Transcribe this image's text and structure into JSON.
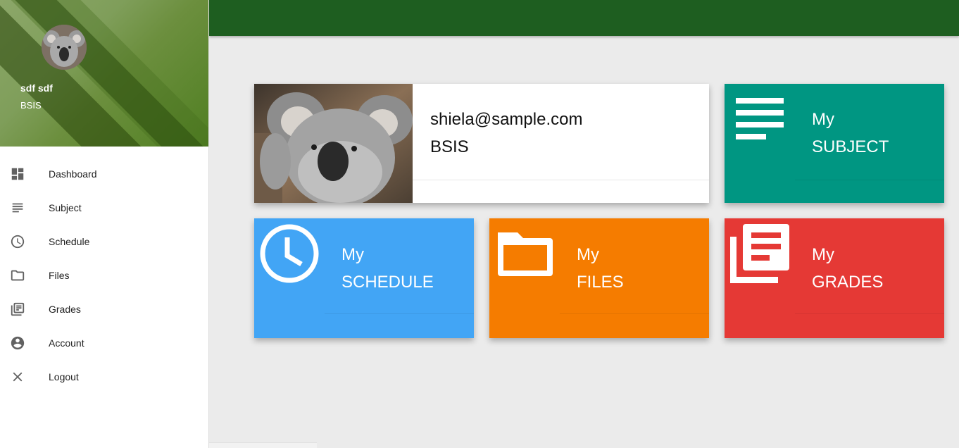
{
  "profile": {
    "name": "sdf sdf",
    "course": "BSIS"
  },
  "nav": {
    "items": [
      {
        "label": "Dashboard",
        "icon": "dashboard-icon"
      },
      {
        "label": "Subject",
        "icon": "subject-icon"
      },
      {
        "label": "Schedule",
        "icon": "clock-icon"
      },
      {
        "label": "Files",
        "icon": "folder-icon"
      },
      {
        "label": "Grades",
        "icon": "library-books-icon"
      },
      {
        "label": "Account",
        "icon": "account-circle-icon"
      },
      {
        "label": "Logout",
        "icon": "close-icon"
      }
    ]
  },
  "main": {
    "info_card": {
      "email": "shiela@sample.com",
      "course": "BSIS"
    },
    "tiles": {
      "subject": {
        "line1": "My",
        "line2": "SUBJECT",
        "color": "#009682"
      },
      "schedule": {
        "line1": "My",
        "line2": "SCHEDULE",
        "color": "#42a5f5"
      },
      "files": {
        "line1": "My",
        "line2": "FILES",
        "color": "#f57c00"
      },
      "grades": {
        "line1": "My",
        "line2": "GRADES",
        "color": "#e53935"
      }
    }
  },
  "colors": {
    "topbar": "#1e5e20",
    "background": "#ebebeb"
  }
}
